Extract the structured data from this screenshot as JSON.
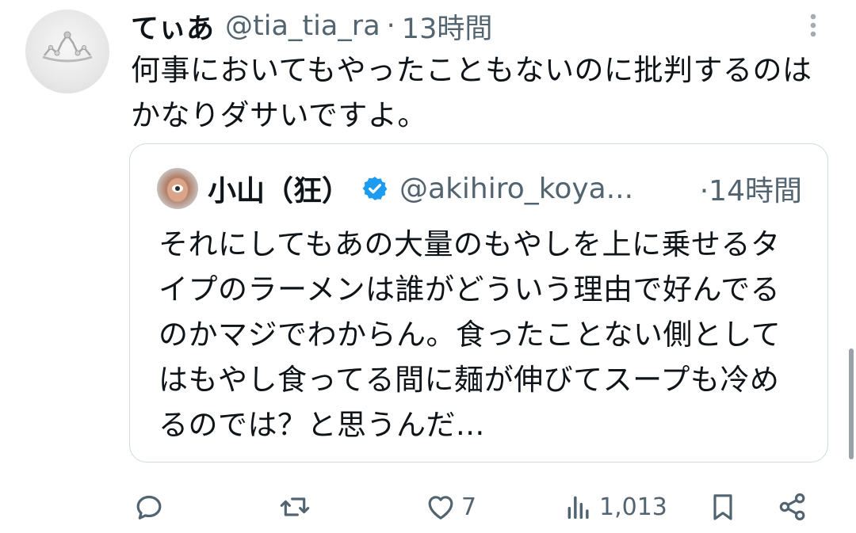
{
  "tweet": {
    "author": {
      "display_name": "てぃあ",
      "handle": "@tia_tia_ra",
      "avatar_icon": "tiara-avatar"
    },
    "separator": "·",
    "time": "13時間",
    "text": "何事においてもやったこともないのに批判するのはかなりダサいですよ。",
    "menu_icon": "more-vertical-icon"
  },
  "quote": {
    "author": {
      "display_name": "小山（狂）",
      "handle": "@akihiro_koya...",
      "verified": true,
      "avatar_icon": "hand-eye-avatar"
    },
    "time": "·14時間",
    "text": "それにしてもあの大量のもやしを上に乗せるタイプのラーメンは誰がどういう理由で好んでるのかマジでわからん。食ったことない側としてはもやし食ってる間に麺が伸びてスープも冷めるのでは？と思うんだ..."
  },
  "actions": {
    "reply": {
      "icon": "reply-icon",
      "count": ""
    },
    "retweet": {
      "icon": "retweet-icon",
      "count": ""
    },
    "like": {
      "icon": "heart-icon",
      "count": "7"
    },
    "views": {
      "icon": "views-icon",
      "count": "1,013"
    },
    "bookmark": {
      "icon": "bookmark-icon"
    },
    "share": {
      "icon": "share-icon"
    }
  },
  "colors": {
    "text_primary": "#0f1419",
    "text_secondary": "#536471",
    "verified_blue": "#1d9bf0",
    "border": "#cfd9de"
  }
}
